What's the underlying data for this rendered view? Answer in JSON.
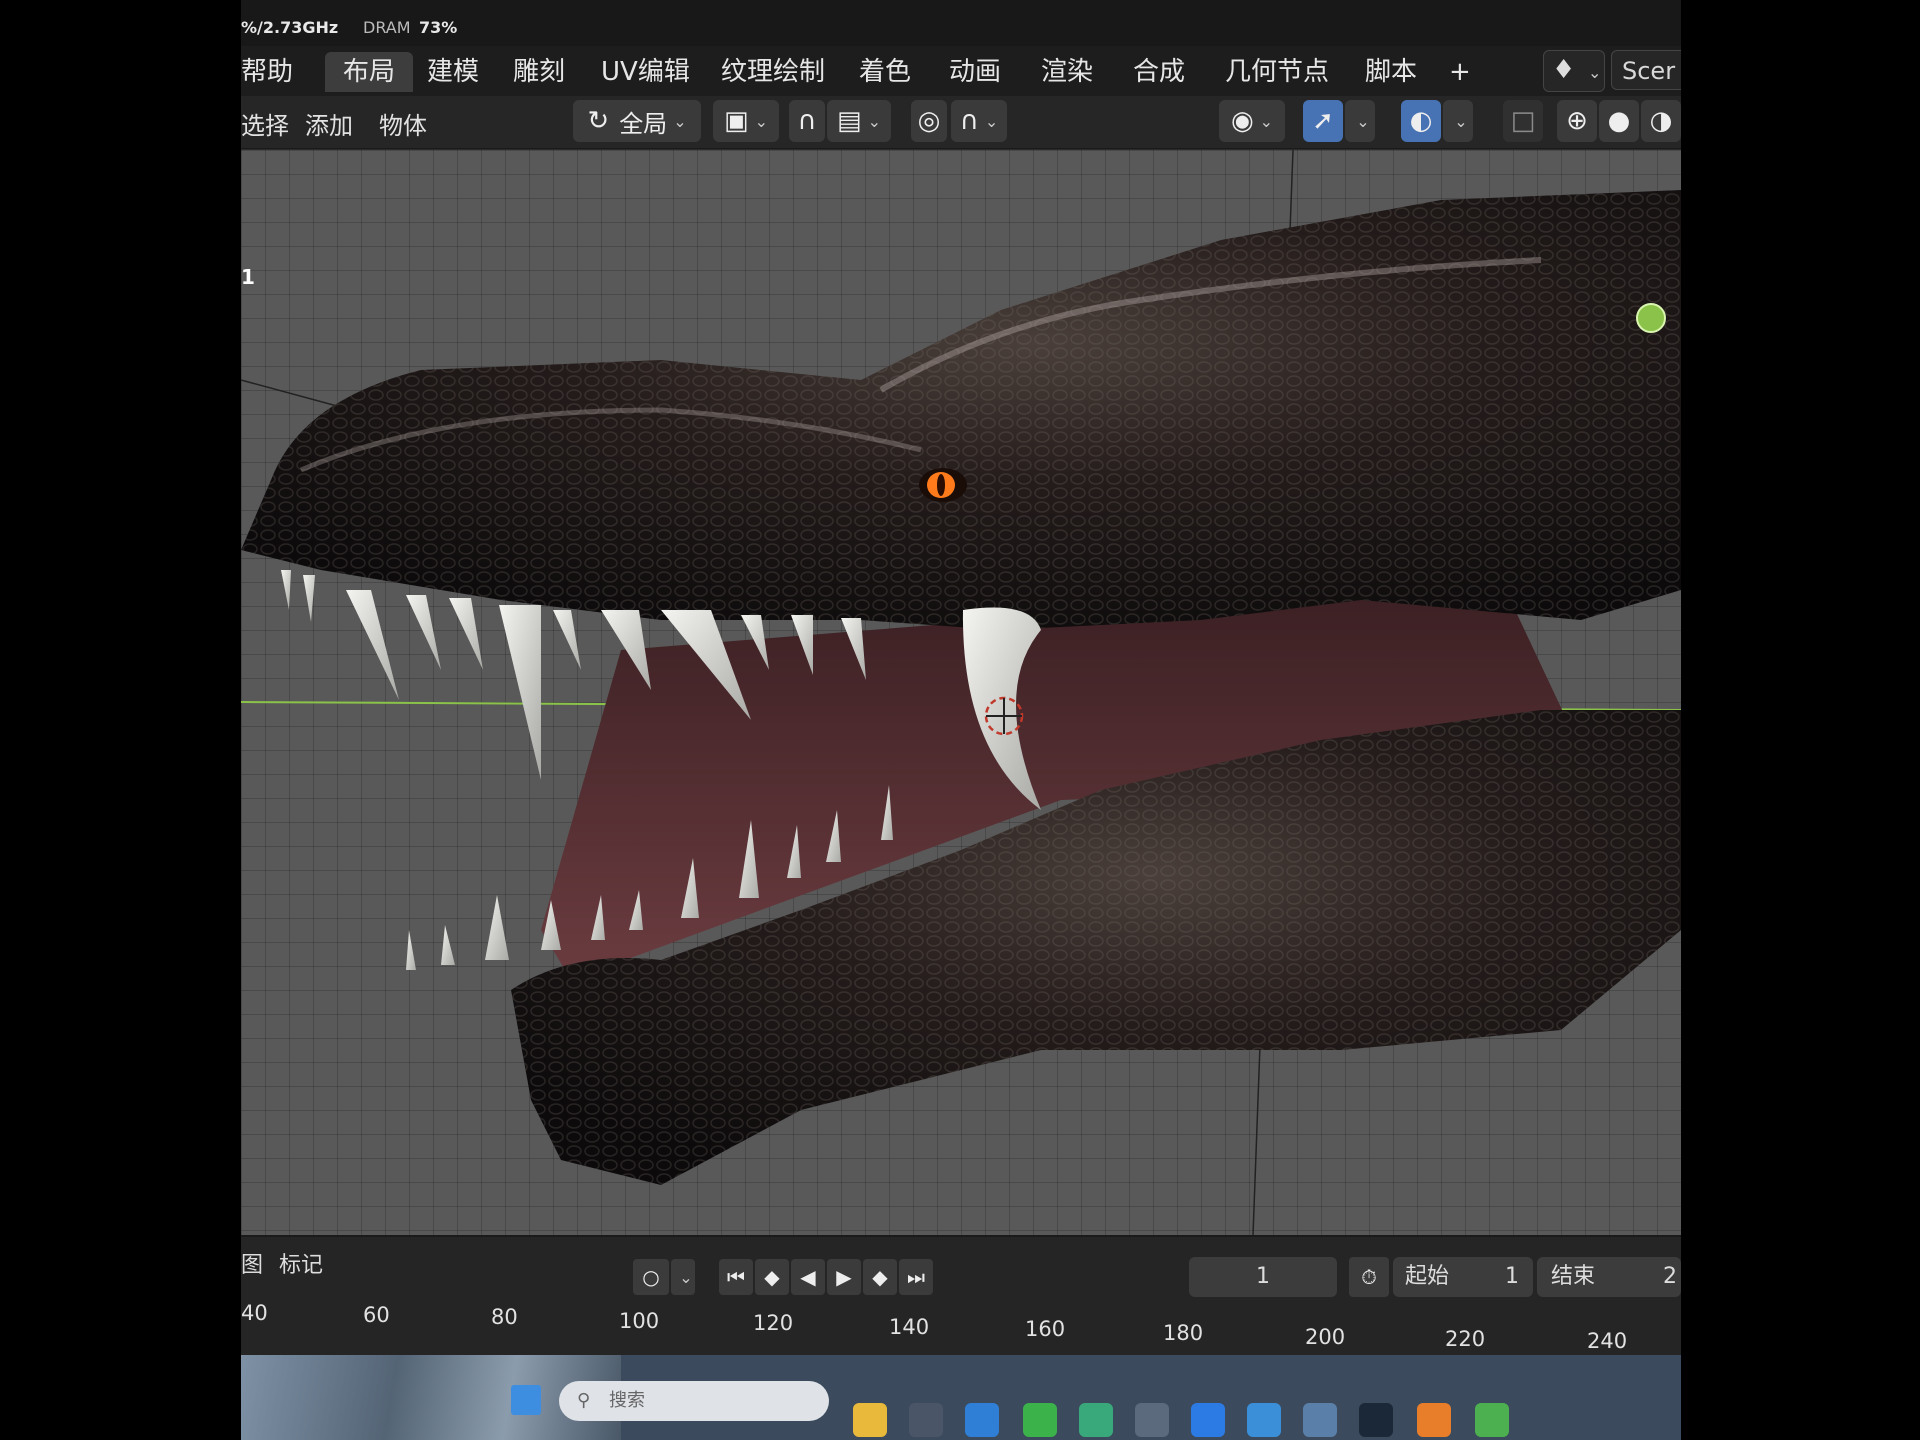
{
  "status": {
    "cpu": "%/2.73GHz",
    "dram_label": "DRAM",
    "dram_value": "73%"
  },
  "workspace_tabs": [
    "帮助",
    "布局",
    "建模",
    "雕刻",
    "UV编辑",
    "纹理绘制",
    "着色",
    "动画",
    "渲染",
    "合成",
    "几何节点",
    "脚本"
  ],
  "add_tab": "+",
  "scene_label": "Scer",
  "header": {
    "menus": [
      "选择",
      "添加",
      "物体"
    ],
    "transform_orientation": "全局"
  },
  "viewport": {
    "corner_label": "1"
  },
  "timeline": {
    "menus": [
      "图",
      "标记"
    ],
    "current_frame": "1",
    "start_label": "起始",
    "start_value": "1",
    "end_label": "结束",
    "end_value": "2",
    "ticks": [
      "40",
      "60",
      "80",
      "100",
      "120",
      "140",
      "160",
      "180",
      "200",
      "220",
      "240"
    ]
  },
  "taskbar": {
    "search_placeholder": "搜索"
  },
  "colors": {
    "accent_blue": "#4772b3",
    "x_axis": "#c0392b",
    "y_axis": "#8bc34a",
    "eye": "#ff7a1a"
  }
}
